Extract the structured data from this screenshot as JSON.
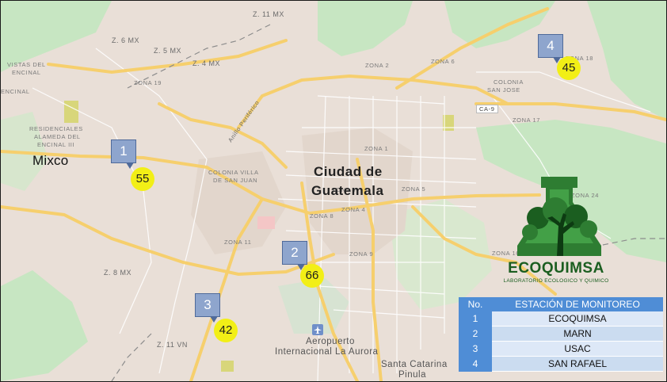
{
  "map": {
    "city": "Ciudad de Guatemala",
    "city_line1": "Ciudad de",
    "city_line2": "Guatemala",
    "places": {
      "mixco": "Mixco",
      "aeropuerto_l1": "Aeropuerto",
      "aeropuerto_l2": "Internacional La Aurora",
      "santa_catarina_l1": "Santa Catarina",
      "santa_catarina_l2": "Pinula",
      "vistas_l1": "VISTAS DEL",
      "vistas_l2": "ENCINAL",
      "residenciales_l1": "RESIDENCIALES",
      "residenciales_l2": "ALAMEDA DEL",
      "residenciales_l3": "ENCINAL III",
      "encinal": "ENCINAL",
      "colonia_villa_l1": "COLONIA VILLA",
      "colonia_villa_l2": "DE SAN JUAN",
      "colonia_sanjose_l1": "COLONIA",
      "colonia_sanjose_l2": "SAN JOSE",
      "anillo": "Anillo Periférico",
      "ca9": "CA-9"
    },
    "zones": {
      "z11mx": "Z. 11 MX",
      "z6mx": "Z. 6 MX",
      "z5mx": "Z. 5 MX",
      "z4mx": "Z. 4 MX",
      "z8mx": "Z. 8 MX",
      "z11vn": "Z. 11 VN",
      "zona19": "ZONA 19",
      "zona2": "ZONA 2",
      "zona6": "ZONA 6",
      "zona18": "ZONA 18",
      "zona17": "ZONA 17",
      "zona1": "ZONA 1",
      "zona3": "ZONA 3",
      "zona5": "ZONA 5",
      "zona8": "ZONA 8",
      "zona4": "ZONA 4",
      "zona11": "ZONA 11",
      "zona9": "ZONA 9",
      "zona24": "ZONA 24",
      "zona16": "ZONA 16"
    }
  },
  "stations": [
    {
      "no": "1",
      "value": "55"
    },
    {
      "no": "2",
      "value": "66"
    },
    {
      "no": "3",
      "value": "42"
    },
    {
      "no": "4",
      "value": "45"
    }
  ],
  "legend": {
    "header_no": "No.",
    "header_name": "ESTACIÓN DE MONITOREO",
    "rows": [
      {
        "no": "1",
        "name": "ECOQUIMSA"
      },
      {
        "no": "2",
        "name": "MARN"
      },
      {
        "no": "3",
        "name": "USAC"
      },
      {
        "no": "4",
        "name": "SAN RAFAEL"
      }
    ]
  },
  "logo": {
    "name": "ECOQUIMSA",
    "subtitle": "LABORATORIO ECOLOGICO Y QUIMICO"
  },
  "colors": {
    "land": "#e9dfd7",
    "green_area": "#c7e6c2",
    "road_major": "#f6cf6d",
    "road_minor": "#ffffff",
    "marker": "#8ea5cd",
    "aq_value": "#f2ef16",
    "legend_header": "#4f8dd6",
    "logo_green": "#1b5e20"
  },
  "icons": [
    "airport-icon",
    "station-marker-icon",
    "logo-tree-icon"
  ]
}
